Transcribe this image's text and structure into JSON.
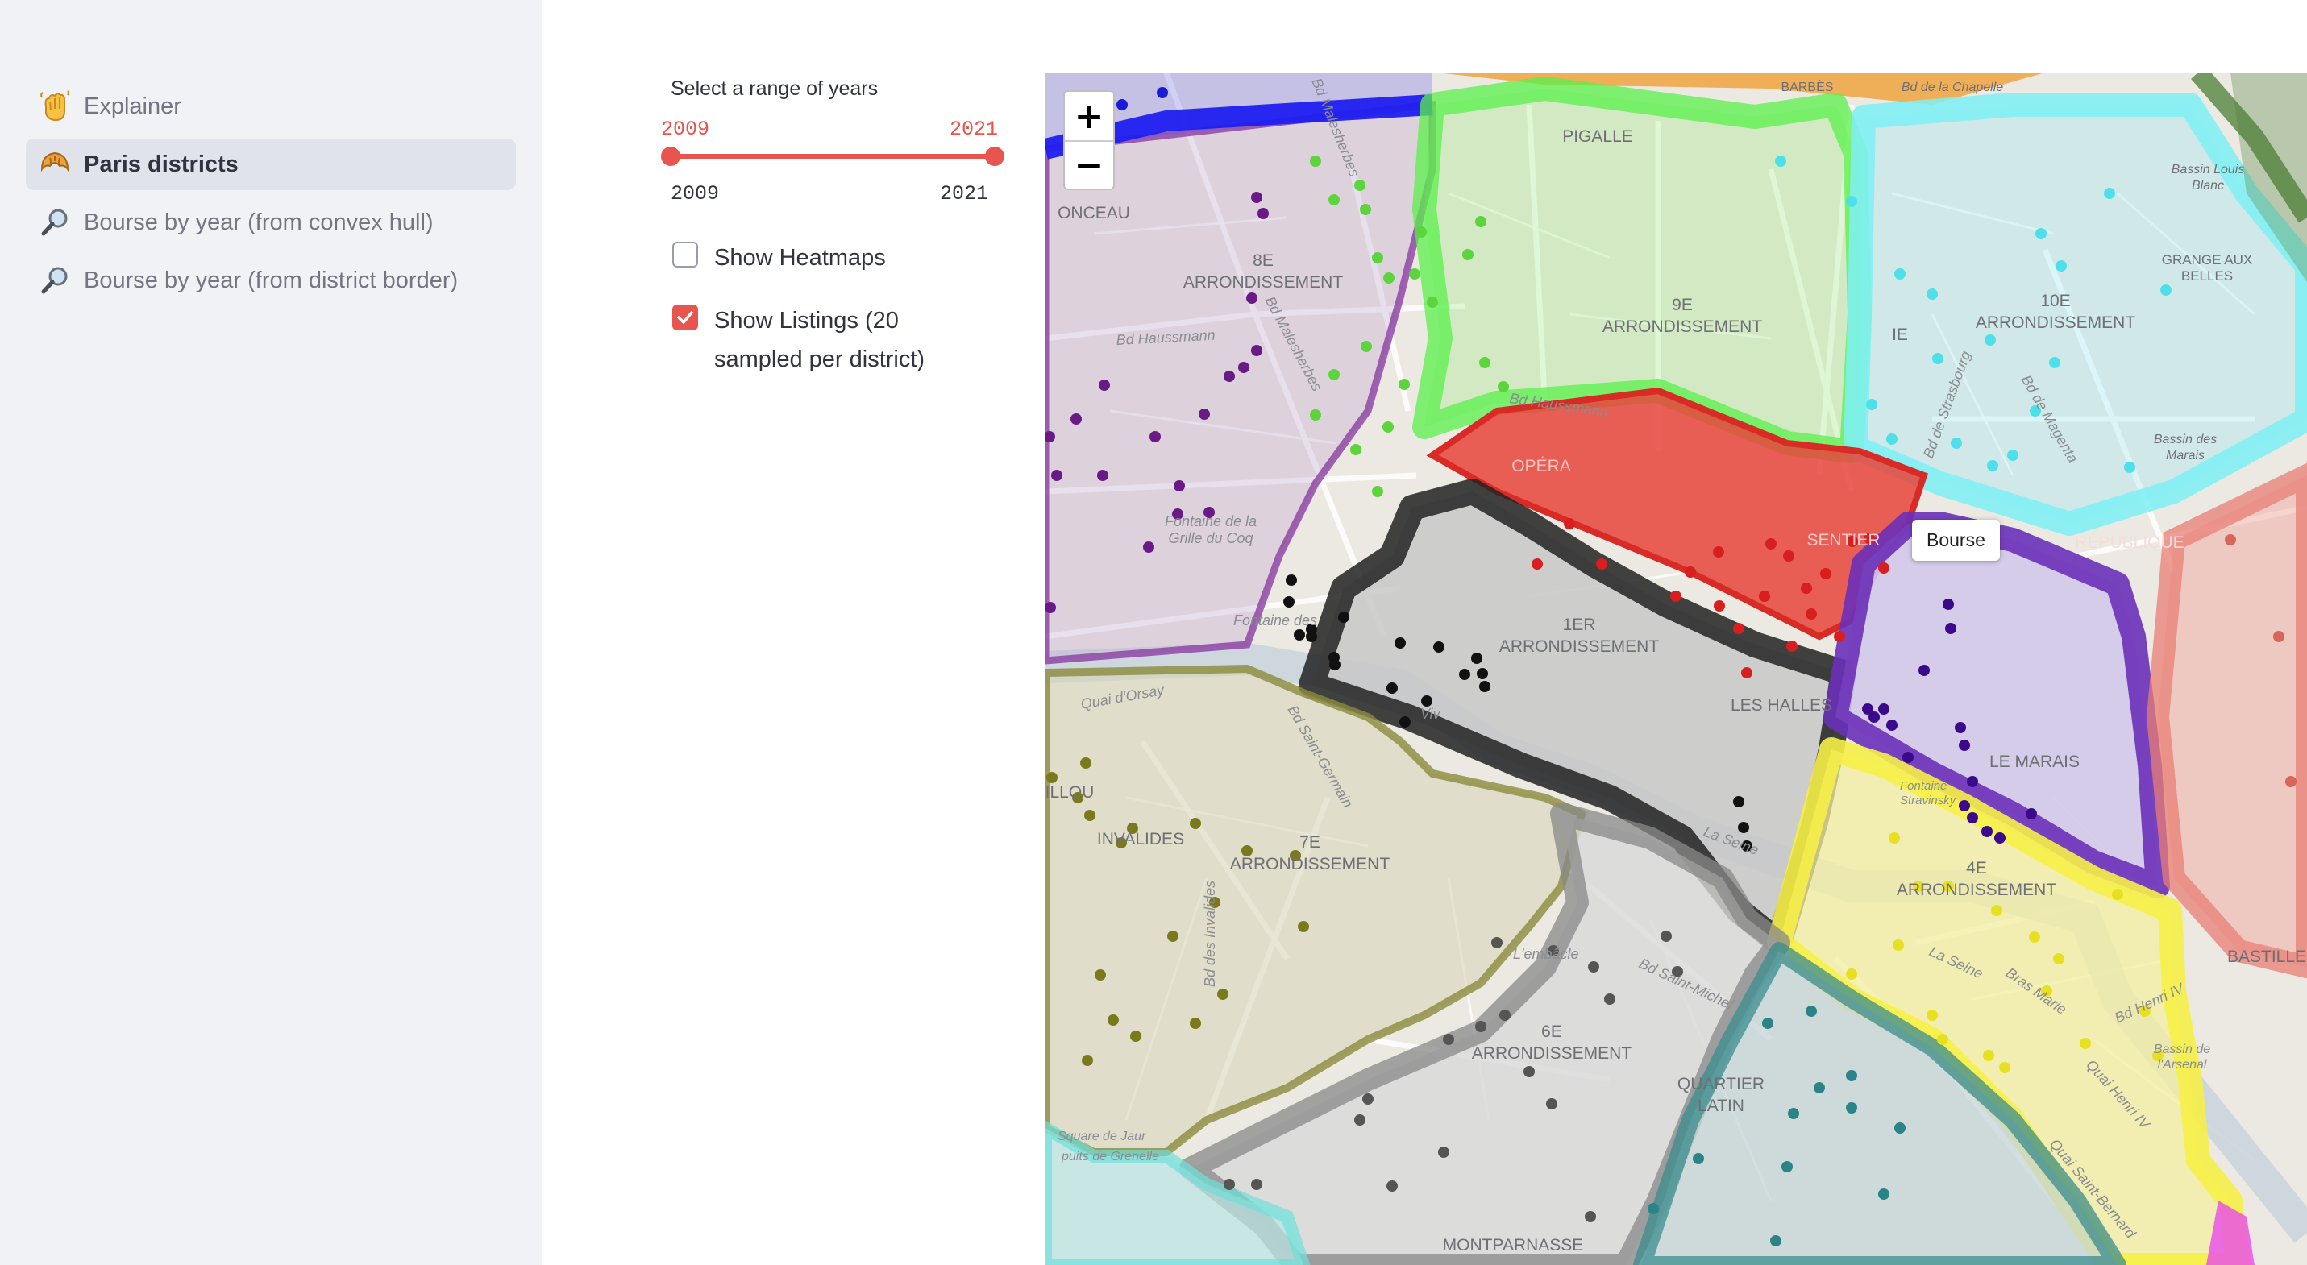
{
  "sidebar": {
    "items": [
      {
        "icon": "waving-hand-icon",
        "label": "Explainer",
        "active": false
      },
      {
        "icon": "croissant-icon",
        "label": "Paris districts",
        "active": true
      },
      {
        "icon": "magnifier-icon",
        "label": "Bourse by year (from convex hull)",
        "active": false
      },
      {
        "icon": "magnifier-icon",
        "label": "Bourse by year (from district border)",
        "active": false
      }
    ]
  },
  "controls": {
    "slider": {
      "caption": "Select a range of years",
      "min_label": "2009",
      "max_label": "2021",
      "low_value": "2009",
      "high_value": "2021",
      "accent_color": "#e8554e"
    },
    "heatmaps": {
      "label": "Show Heatmaps",
      "checked": false
    },
    "listings": {
      "label": "Show Listings (20 sampled per district)",
      "checked": true
    }
  },
  "map": {
    "zoom_in": "+",
    "zoom_out": "−",
    "tooltip": "Bourse",
    "labels": {
      "ponceau": "ONCEAU",
      "pigalle": "PIGALLE",
      "barbes": "BARBÈS",
      "barbes_street": "Bd de la Chapelle",
      "arr8": "8E",
      "arr8b": "ARRONDISSEMENT",
      "arr9": "9E",
      "arr9b": "ARRONDISSEMENT",
      "arr10": "10E",
      "arr10b": "ARRONDISSEMENT",
      "arr1": "1ER",
      "arr1b": "ARRONDISSEMENT",
      "arr7": "7E",
      "arr7b": "ARRONDISSEMENT",
      "arr6": "6E",
      "arr6b": "ARRONDISSEMENT",
      "arr4": "4E",
      "arr4b": "ARRONDISSEMENT",
      "opera": "OPÉRA",
      "sentier": "SENTIER",
      "republique": "RÉPUBLIQUE",
      "halles": "LES HALLES",
      "marais": "LE MARAIS",
      "bastille": "BASTILLE",
      "invalides": "INVALIDES",
      "illou": "ILLOU",
      "quartier": "QUARTIER",
      "latin": "LATIN",
      "montparnasse": "MONTPARNASSE",
      "grange1": "GRANGE AUX",
      "grange2": "BELLES",
      "bassin_louis1": "Bassin Louis",
      "bassin_louis2": "Blanc",
      "bassin_marais1": "Bassin des",
      "bassin_marais2": "Marais",
      "ie": "IE",
      "bd_haussmann": "Bd Haussmann",
      "bd_haussmann2": "Bd Haussmann",
      "bd_malesherbes": "Bd Malesherbes",
      "bd_malesherbes2": "Bd Malesherbes",
      "bd_strasbourg": "Bd de Strasbourg",
      "bd_magenta": "Bd de Magenta",
      "fontaine_coq1": "Fontaine de la",
      "fontaine_coq2": "Grille du Coq",
      "fontaine_des": "Fontaine des",
      "quai_orsay": "Quai d'Orsay",
      "bd_st_germain": "Bd Saint-Germain",
      "bd_invalides": "Bd des Invalides",
      "viv": "Viv",
      "fontaine_str1": "Fontaine",
      "fontaine_str2": "Stravinsky",
      "la_seine": "La Seine",
      "la_seine2": "La Seine",
      "bras_marie": "Bras Marie",
      "bd_henri": "Bd Henri IV",
      "quai_henri": "Quai Henri IV",
      "quai_st_bernard": "Quai Saint-Bernard",
      "bassin_arsenal1": "Bassin de",
      "bassin_arsenal2": "l'Arsenal",
      "lembacle": "L'embâcle",
      "bd_st_michel": "Bd Saint-Michel",
      "puits": "puits de Grenelle",
      "jaures": "Square de Jaur"
    }
  }
}
